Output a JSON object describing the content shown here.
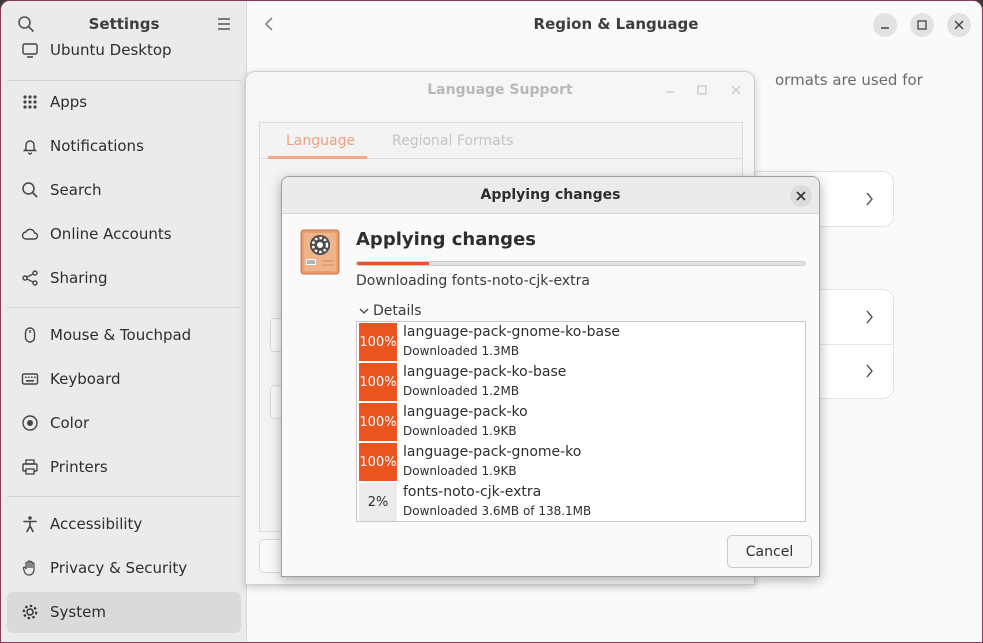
{
  "sidebar": {
    "title": "Settings",
    "items": [
      {
        "label": "Ubuntu Desktop",
        "icon": "ubuntu-desktop-icon"
      },
      {
        "label": "Apps",
        "icon": "apps-grid-icon"
      },
      {
        "label": "Notifications",
        "icon": "bell-icon"
      },
      {
        "label": "Search",
        "icon": "search-icon"
      },
      {
        "label": "Online Accounts",
        "icon": "cloud-icon"
      },
      {
        "label": "Sharing",
        "icon": "share-icon"
      },
      {
        "label": "Mouse & Touchpad",
        "icon": "mouse-icon"
      },
      {
        "label": "Keyboard",
        "icon": "keyboard-icon"
      },
      {
        "label": "Color",
        "icon": "color-icon"
      },
      {
        "label": "Printers",
        "icon": "printer-icon"
      },
      {
        "label": "Accessibility",
        "icon": "accessibility-icon"
      },
      {
        "label": "Privacy & Security",
        "icon": "hand-icon"
      },
      {
        "label": "System",
        "icon": "gear-icon"
      }
    ],
    "active": "System"
  },
  "main": {
    "title": "Region & Language",
    "partial_text": "ormats are used for"
  },
  "language_support": {
    "title": "Language Support",
    "tabs": [
      "Language",
      "Regional Formats"
    ],
    "active_tab": "Language"
  },
  "dialog": {
    "title": "Applying changes",
    "heading": "Applying changes",
    "progress_percent": 16,
    "status": "Downloading fonts-noto-cjk-extra",
    "details_label": "Details",
    "cancel_label": "Cancel",
    "downloads": [
      {
        "percent": "100%",
        "name": "language-pack-gnome-ko-base",
        "size": "Downloaded 1.3MB",
        "complete": true
      },
      {
        "percent": "100%",
        "name": "language-pack-ko-base",
        "size": "Downloaded 1.2MB",
        "complete": true
      },
      {
        "percent": "100%",
        "name": "language-pack-ko",
        "size": "Downloaded 1.9KB",
        "complete": true
      },
      {
        "percent": "100%",
        "name": "language-pack-gnome-ko",
        "size": "Downloaded 1.9KB",
        "complete": true
      },
      {
        "percent": "2%",
        "name": "fonts-noto-cjk-extra",
        "size": "Downloaded 3.6MB of 138.1MB",
        "complete": false
      }
    ]
  },
  "colors": {
    "accent": "#e95420",
    "window_border": "#8a3a5c"
  }
}
